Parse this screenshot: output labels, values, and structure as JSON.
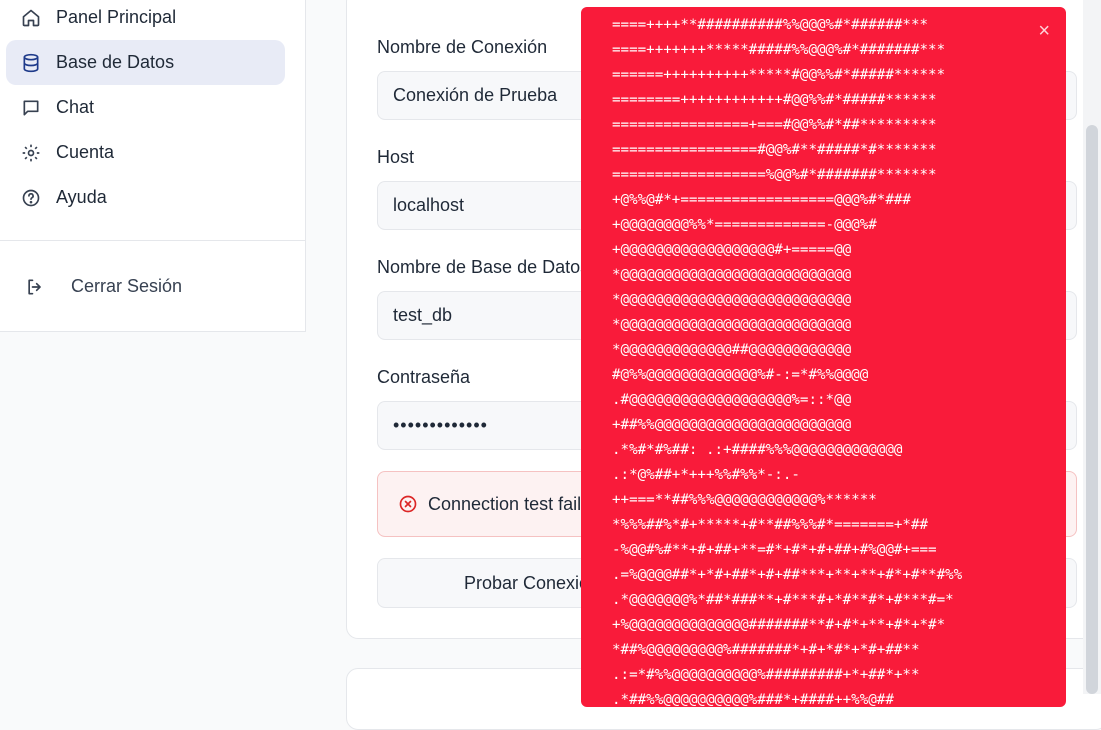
{
  "sidebar": {
    "items": [
      {
        "label": "Panel Principal",
        "icon": "home-icon"
      },
      {
        "label": "Base de Datos",
        "icon": "database-icon",
        "active": true
      },
      {
        "label": "Chat",
        "icon": "chat-icon"
      },
      {
        "label": "Cuenta",
        "icon": "gear-icon"
      },
      {
        "label": "Ayuda",
        "icon": "help-icon"
      }
    ],
    "logout_label": "Cerrar Sesión"
  },
  "form": {
    "connection_name_label": "Nombre de Conexión",
    "connection_name_value": "Conexión de Prueba",
    "host_label": "Host",
    "host_value": "localhost",
    "database_name_label": "Nombre de Base de Datos",
    "database_name_value": "test_db",
    "password_label": "Contraseña",
    "password_value": "•••••••••••••",
    "error_message": "Connection test failed",
    "test_button_label": "Probar Conexión"
  },
  "toast": {
    "close_label": "×",
    "background": "#f91b3a",
    "ascii_lines": [
      "====++++**##########%%@@@%#*######***",
      "====+++++++*****#####%%@@@%#*#######***",
      "======++++++++++*****#@@%%#*#####******",
      "========++++++++++++#@@%%#*#####******",
      "================+===#@@%%#*##*********",
      "=================#@@%#**#####*#*******",
      "==================%@@%#*#######*******",
      "+@%%@#*+==================@@@%#*###",
      "+@@@@@@@@%%*=============-@@@%#",
      "+@@@@@@@@@@@@@@@@@@#+=====@@",
      "*@@@@@@@@@@@@@@@@@@@@@@@@@@@",
      "*@@@@@@@@@@@@@@@@@@@@@@@@@@@",
      "*@@@@@@@@@@@@@@@@@@@@@@@@@@@",
      "*@@@@@@@@@@@@@##@@@@@@@@@@@@",
      "#@%%@@@@@@@@@@@@@%#-:=*#%%@@@@",
      ".#@@@@@@@@@@@@@@@@@@@%=::*@@",
      "+##%%@@@@@@@@@@@@@@@@@@@@@@@",
      ".*%#*#%##: .:+####%%%@@@@@@@@@@@@@",
      ".:*@%##+*+++%%#%%*-:.-",
      "++===**##%%%@@@@@@@@@@@@%******",
      "*%%%##%*#+*****+#**##%%%#*=======+*##",
      "-%@@#%#**+#+##+**=#*+#*+#+##+#%@@#+===",
      ".=%@@@@##*+*#+##*+#+##***+**+**+#*+#**#%%",
      ".*@@@@@@@%*##*###**+#***#+*#**#*+#***#=*",
      "+%@@@@@@@@@@@@@@#######**#+#*+**+#*+*#*",
      "*##%@@@@@@@@@%#######*+#+*#*+*#+##**",
      ".:=*#%%@@@@@@@@@@%#########+*+##*+**",
      ".*##%%@@@@@@@@@@%###*+####++%%@##"
    ]
  }
}
